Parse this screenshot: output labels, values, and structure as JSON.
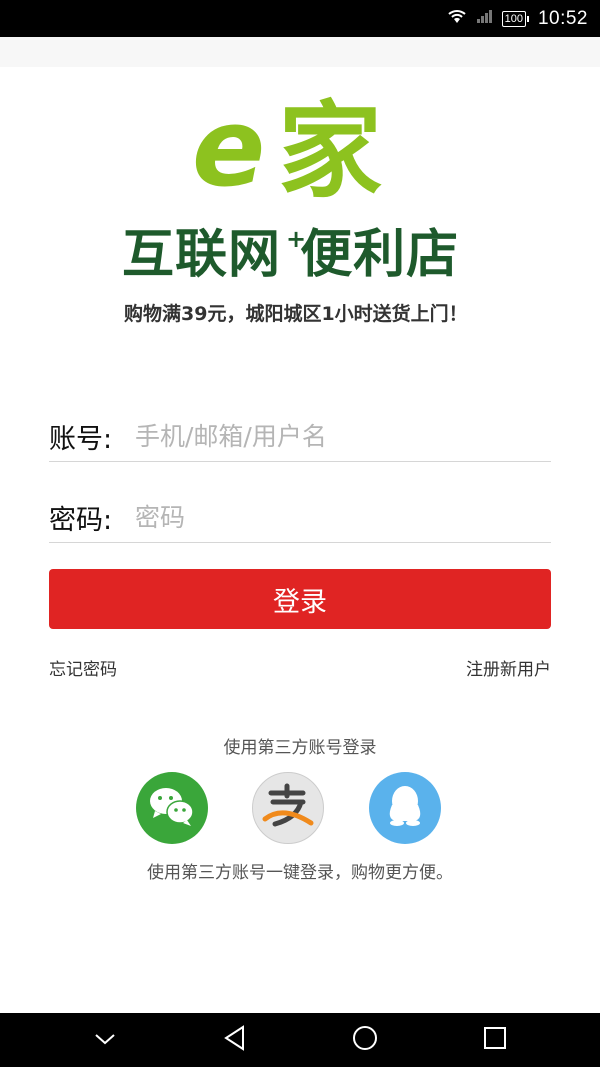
{
  "status_bar": {
    "time": "10:52",
    "battery": "100"
  },
  "logo": {
    "brand_e": "e",
    "brand_jia": "家",
    "slogan_main": "互联网 便利店",
    "slogan_plus": "+",
    "tagline": "购物满39元，城阳城区1小时送货上门！"
  },
  "form": {
    "account_label": "账号:",
    "account_placeholder": "手机/邮箱/用户名",
    "account_value": "",
    "password_label": "密码:",
    "password_placeholder": "密码",
    "password_value": ""
  },
  "login_button": "登录",
  "links": {
    "forgot": "忘记密码",
    "register": "注册新用户"
  },
  "third_party": {
    "title": "使用第三方账号登录",
    "subtitle": "使用第三方账号一键登录，购物更方便。",
    "providers": [
      {
        "name": "wechat",
        "icon": "wechat-icon",
        "color": "#3aa63a"
      },
      {
        "name": "alipay",
        "icon": "alipay-icon",
        "color": "#e6e6e6"
      },
      {
        "name": "qq",
        "icon": "qq-icon",
        "color": "#5ab2ec"
      }
    ]
  },
  "colors": {
    "accent": "#e02423",
    "brand_green": "#8dc21f",
    "brand_dark_green": "#1e5a2c"
  }
}
